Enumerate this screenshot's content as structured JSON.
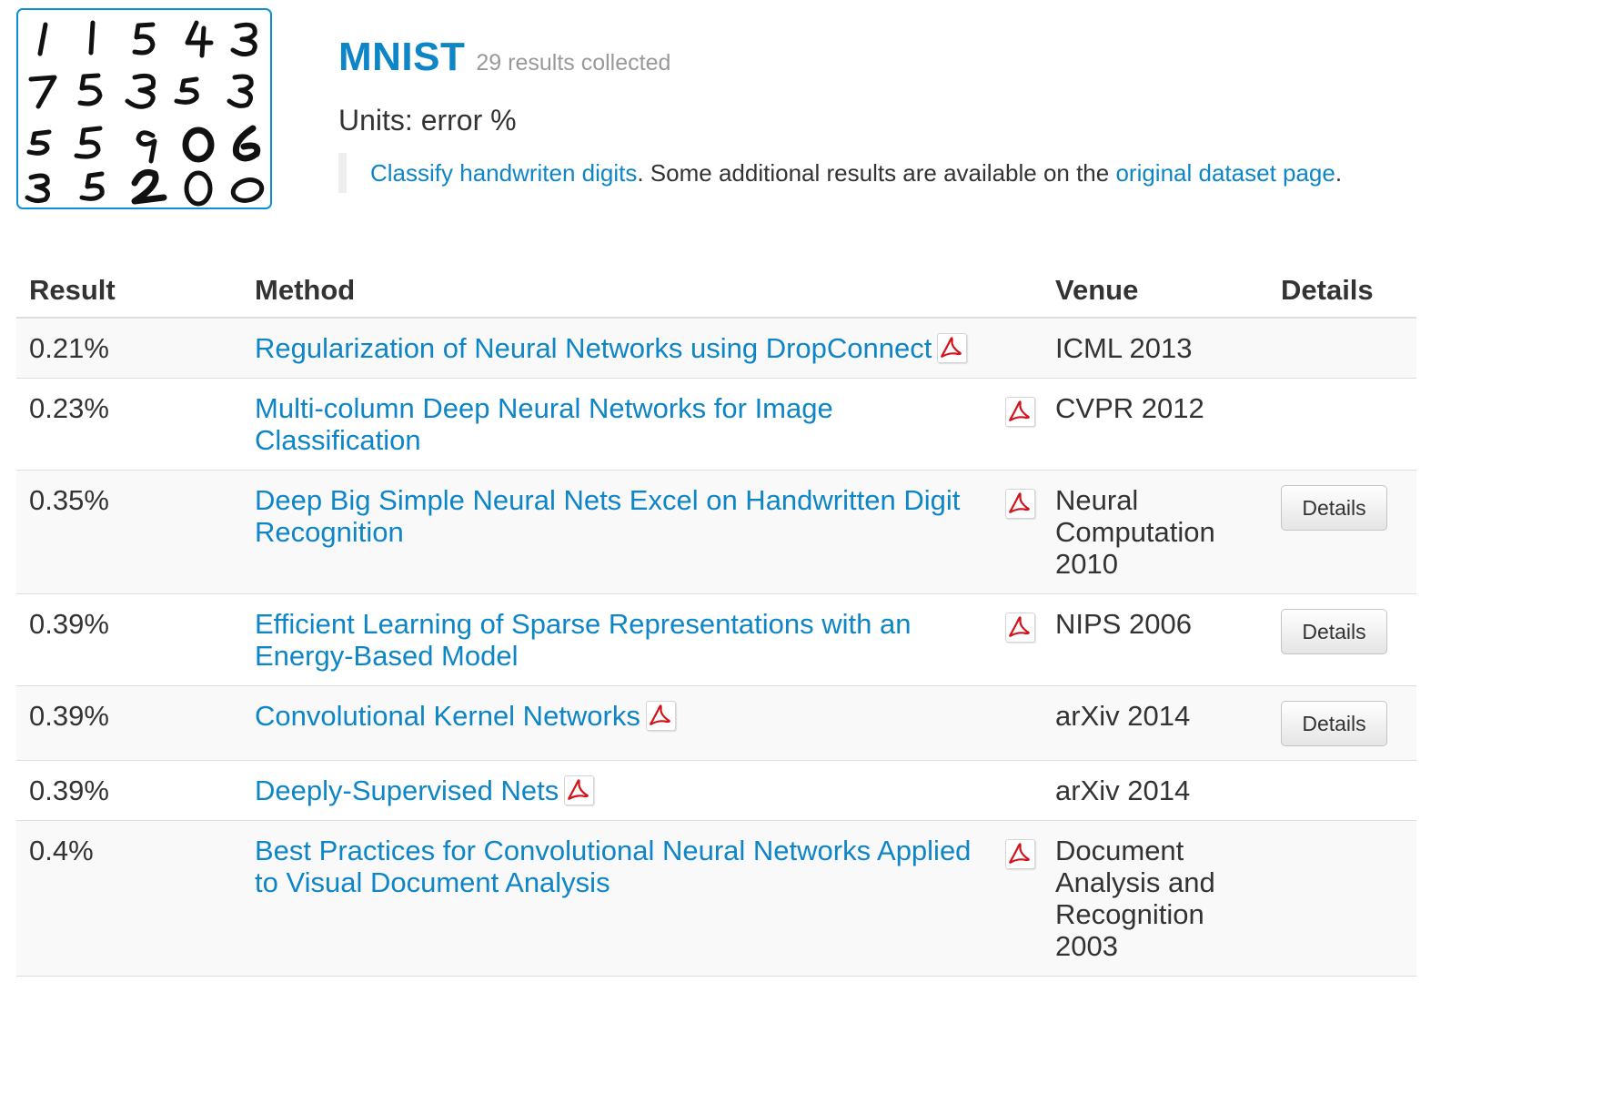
{
  "dataset": {
    "title": "MNIST",
    "count": "29 results collected",
    "units": "Units: error %",
    "desc_link": "Classify handwriten digits",
    "desc_text": ". Some additional results are available on the ",
    "desc_link2": "original dataset page",
    "desc_end": "."
  },
  "table": {
    "headers": [
      "Result",
      "Method",
      "Venue",
      "Details"
    ],
    "rows": [
      {
        "result": "0.21%",
        "method": "Regularization of Neural Networks using DropConnect",
        "venue": "ICML 2013",
        "details": ""
      },
      {
        "result": "0.23%",
        "method": "Multi-column Deep Neural Networks for Image Classification",
        "venue": "CVPR 2012",
        "details": ""
      },
      {
        "result": "0.35%",
        "method": "Deep Big Simple Neural Nets Excel on Handwritten Digit Recognition",
        "venue": "Neural Computation 2010",
        "details": "Details"
      },
      {
        "result": "0.39%",
        "method": "Efficient Learning of Sparse Representations with an Energy-Based Model",
        "venue": "NIPS 2006",
        "details": "Details"
      },
      {
        "result": "0.39%",
        "method": "Convolutional Kernel Networks",
        "venue": "arXiv 2014",
        "details": "Details"
      },
      {
        "result": "0.39%",
        "method": "Deeply-Supervised Nets",
        "venue": "arXiv 2014",
        "details": ""
      },
      {
        "result": "0.4%",
        "method": "Best Practices for Convolutional Neural Networks Applied to Visual Document Analysis",
        "venue": "Document Analysis and Recognition 2003",
        "details": ""
      }
    ]
  },
  "icons": {
    "pdf": "pdf-icon",
    "thumbnail": "mnist-digits-thumbnail"
  },
  "colors": {
    "link": "#0d85c7",
    "pdf_red": "#d4121a",
    "border": "#dddddd"
  }
}
